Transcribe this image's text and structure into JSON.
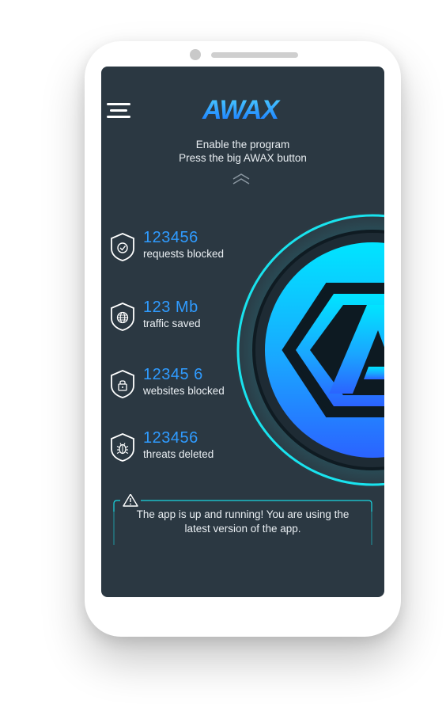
{
  "app": {
    "logo_text": "AWAX",
    "hint_line_1": "Enable the program",
    "hint_line_2": "Press the big AWAX button"
  },
  "stats": [
    {
      "icon": "shield-check-icon",
      "value": "123456",
      "label": "requests blocked"
    },
    {
      "icon": "shield-globe-icon",
      "value": "123 Mb",
      "label": "traffic saved"
    },
    {
      "icon": "shield-lock-icon",
      "value": "12345 6",
      "label": "websites blocked"
    },
    {
      "icon": "shield-bug-icon",
      "value": "123456",
      "label": "threats deleted"
    }
  ],
  "status": {
    "icon": "warning-triangle-icon",
    "line_1": "The app is up and running! You are using the",
    "line_2": "latest version of the app."
  },
  "colors": {
    "screen_bg": "#2b3842",
    "accent_blue": "#2f9bff",
    "accent_cyan": "#19e3ee",
    "text": "#e9eef2"
  }
}
